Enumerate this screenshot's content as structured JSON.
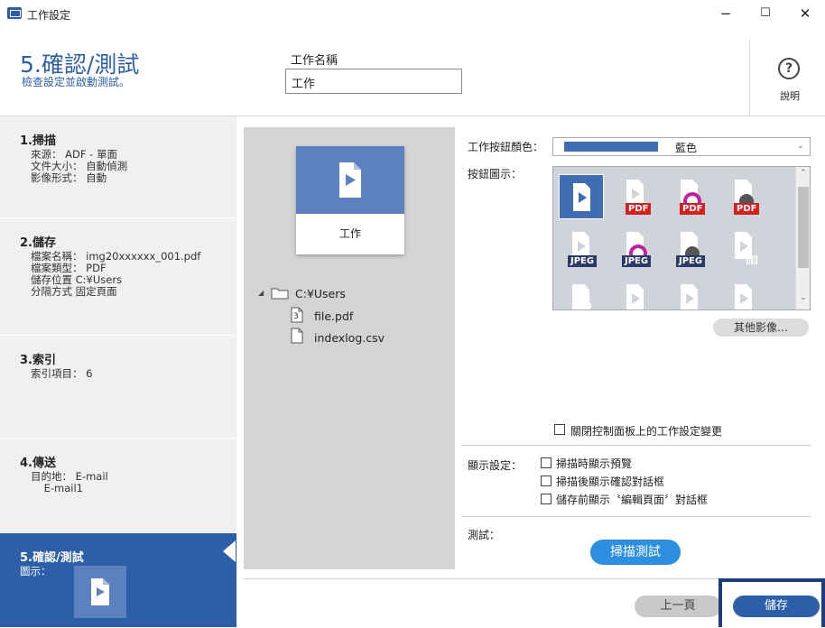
{
  "window": {
    "title": "工作設定",
    "minimize": "−",
    "maximize": "☐",
    "close": "✕"
  },
  "header": {
    "step_title": "5.確認/測試",
    "step_subtitle": "檢查設定並啟動測試。",
    "job_name_label": "工作名稱",
    "job_name_value": "工作",
    "help_label": "說明",
    "help_icon": "?"
  },
  "sidebar": {
    "items": [
      {
        "title": "1.掃描",
        "lines": [
          "來源： ADF - 單面",
          "文件大小： 自動偵測",
          "影像形式： 自動"
        ]
      },
      {
        "title": "2.儲存",
        "lines": [
          "檔案名稱： img20xxxxxx_001.pdf",
          "檔案類型： PDF",
          "儲存位置 C:¥Users",
          "分隔方式 固定頁面"
        ]
      },
      {
        "title": "3.索引",
        "lines": [
          "索引項目： 6"
        ]
      },
      {
        "title": "4.傳送",
        "lines": [
          "目的地： E-mail",
          "    E-mail1"
        ]
      },
      {
        "title": "5.確認/測試",
        "lines": [
          "圖示："
        ]
      }
    ]
  },
  "preview": {
    "job_tile_label": "工作",
    "tree": {
      "folder": "C:¥Users",
      "files": [
        {
          "name": "file.pdf",
          "count": "3"
        },
        {
          "name": "indexlog.csv"
        }
      ]
    }
  },
  "settings": {
    "button_color_label": "工作按鈕顏色：",
    "button_color_value": "藍色",
    "button_color_hex": "#3e6db4",
    "button_icon_label": "按鈕圖示：",
    "icon_badges": [
      "PDF",
      "PDF",
      "PDF",
      "JPEG",
      "JPEG",
      "JPEG"
    ],
    "other_images_button": "其他影像…",
    "panel_lock_label": "關閉控制面板上的工作設定變更",
    "display_settings_label": "顯示設定：",
    "display_options": [
      "掃描時顯示預覽",
      "掃描後顯示確認對話框",
      "儲存前顯示〝編輯頁面〞對話框"
    ],
    "test_label": "測試：",
    "test_button": "掃描測試"
  },
  "footer": {
    "prev_button": "上一頁",
    "save_button": "儲存"
  },
  "colors": {
    "accent": "#2d5fa8",
    "test_button": "#2d8fe0",
    "pdf_badge": "#d42020",
    "jpeg_badge": "#2b3a66"
  }
}
